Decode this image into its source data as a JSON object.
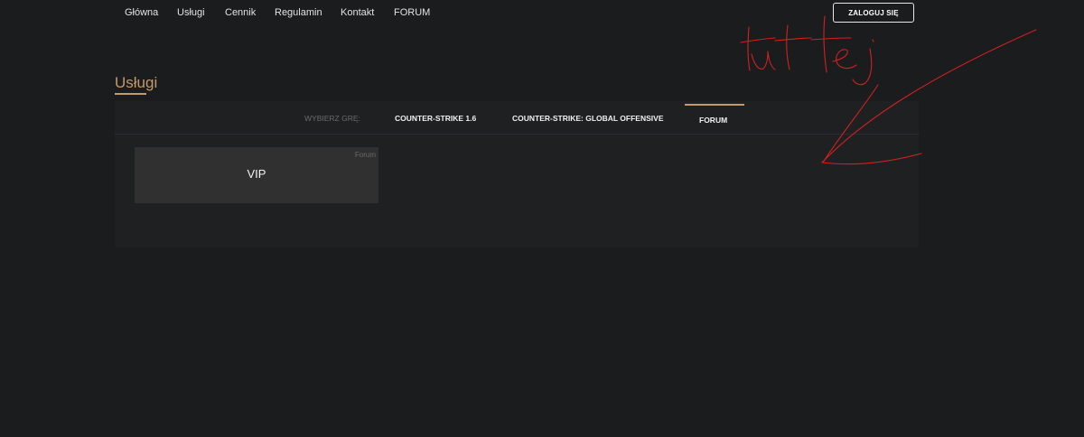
{
  "nav": {
    "items": [
      "Główna",
      "Usługi",
      "Cennik",
      "Regulamin",
      "Kontakt",
      "FORUM"
    ],
    "login_label": "ZALOGUJ SIĘ"
  },
  "page": {
    "title": "Usługi"
  },
  "games": {
    "label": "WYBIERZ GRĘ:",
    "tabs": [
      "COUNTER-STRIKE 1.6",
      "COUNTER-STRIKE: GLOBAL OFFENSIVE",
      "FORUM"
    ],
    "active_tab": "FORUM"
  },
  "services": [
    {
      "title": "VIP",
      "tag": "Forum"
    }
  ],
  "annotation": {
    "text": "tutej",
    "color": "#d42020"
  },
  "colors": {
    "background": "#1b1c1e",
    "panel": "#1f2022",
    "card": "#303030",
    "accent": "#c29a6d"
  }
}
